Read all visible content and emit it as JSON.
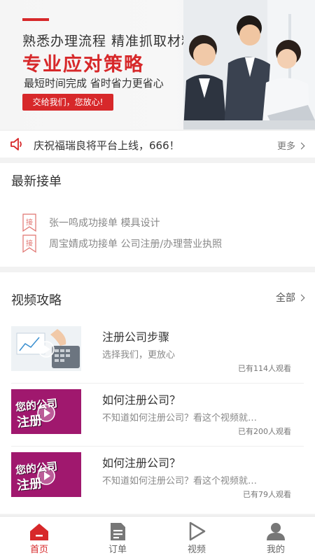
{
  "banner": {
    "line1": "熟悉办理流程 精准抓取材料",
    "line2": "专业应对策略",
    "line3": "最短时间完成 省时省力更省心",
    "cta": "交给我们，您放心!"
  },
  "notice": {
    "text": "庆祝福瑞良将平台上线，666！",
    "more": "更多"
  },
  "orders": {
    "title": "最新接单",
    "tag": "接",
    "items": [
      "张一鸣成功接单 模具设计",
      "周宝婧成功接单 公司注册/办理营业执照"
    ]
  },
  "videos": {
    "title": "视频攻略",
    "all": "全部",
    "items": [
      {
        "title": "注册公司步骤",
        "desc": "选择我们，更放心",
        "views": "已有114人观看"
      },
      {
        "title": "如何注册公司？",
        "desc": "不知道如何注册公司？看这个视频就…",
        "views": "已有200人观看"
      },
      {
        "title": "如何注册公司？",
        "desc": "不知道如何注册公司？看这个视频就…",
        "views": "已有79人观看"
      }
    ],
    "thumb_text": "您的公司",
    "thumb_text2": "注册"
  },
  "tabs": [
    {
      "label": "首页",
      "icon": "home-icon"
    },
    {
      "label": "订单",
      "icon": "order-icon"
    },
    {
      "label": "视频",
      "icon": "video-icon"
    },
    {
      "label": "我的",
      "icon": "user-icon"
    }
  ],
  "colors": {
    "accent": "#d7282a",
    "tag": "#e0736f",
    "thumb_purple": "#a0186e"
  }
}
